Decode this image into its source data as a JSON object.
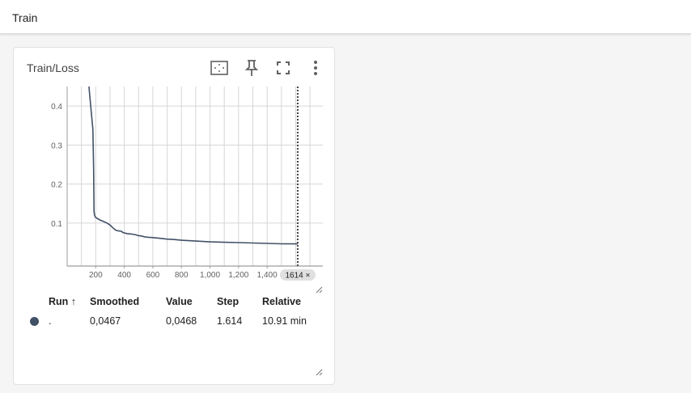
{
  "topbar": {
    "title": "Train"
  },
  "card": {
    "title": "Train/Loss",
    "tools": [
      "fit-domain-icon",
      "pin-icon",
      "fullscreen-icon",
      "more-vert-icon"
    ]
  },
  "colors": {
    "series": "#425066",
    "grid": "#d6d6d6",
    "axis": "#9e9e9e",
    "cursor": "#424242"
  },
  "chart_data": {
    "type": "line",
    "title": "Train/Loss",
    "x_ticks": [
      "200",
      "400",
      "600",
      "800",
      "1,000",
      "1,200",
      "1,400"
    ],
    "y_ticks": [
      "0.1",
      "0.2",
      "0.3",
      "0.4"
    ],
    "xlim": [
      0,
      1790
    ],
    "ylim": [
      -0.01,
      0.45
    ],
    "grid": true,
    "cursor_step": 1614,
    "cursor_label": "1614 ×",
    "series": [
      {
        "x": [
          150,
          165,
          175,
          180,
          185,
          188,
          192,
          198,
          210,
          230,
          250,
          280,
          300,
          320,
          340,
          360,
          380,
          390,
          400,
          420,
          450,
          480,
          500,
          520,
          540,
          560,
          600,
          650,
          700,
          750,
          800,
          850,
          900,
          1000,
          1100,
          1200,
          1300,
          1400,
          1500,
          1614
        ],
        "y": [
          0.46,
          0.4,
          0.36,
          0.34,
          0.24,
          0.13,
          0.12,
          0.115,
          0.112,
          0.108,
          0.105,
          0.1,
          0.095,
          0.088,
          0.082,
          0.08,
          0.079,
          0.076,
          0.075,
          0.073,
          0.072,
          0.07,
          0.068,
          0.067,
          0.065,
          0.064,
          0.063,
          0.061,
          0.059,
          0.058,
          0.056,
          0.055,
          0.054,
          0.052,
          0.051,
          0.05,
          0.049,
          0.048,
          0.047,
          0.0467
        ]
      }
    ]
  },
  "table": {
    "headers": [
      "Run ↑",
      "Smoothed",
      "Value",
      "Step",
      "Relative"
    ],
    "rows": [
      {
        "run": ".",
        "smoothed": "0,0467",
        "value": "0,0468",
        "step": "1.614",
        "relative": "10.91 min"
      }
    ]
  }
}
